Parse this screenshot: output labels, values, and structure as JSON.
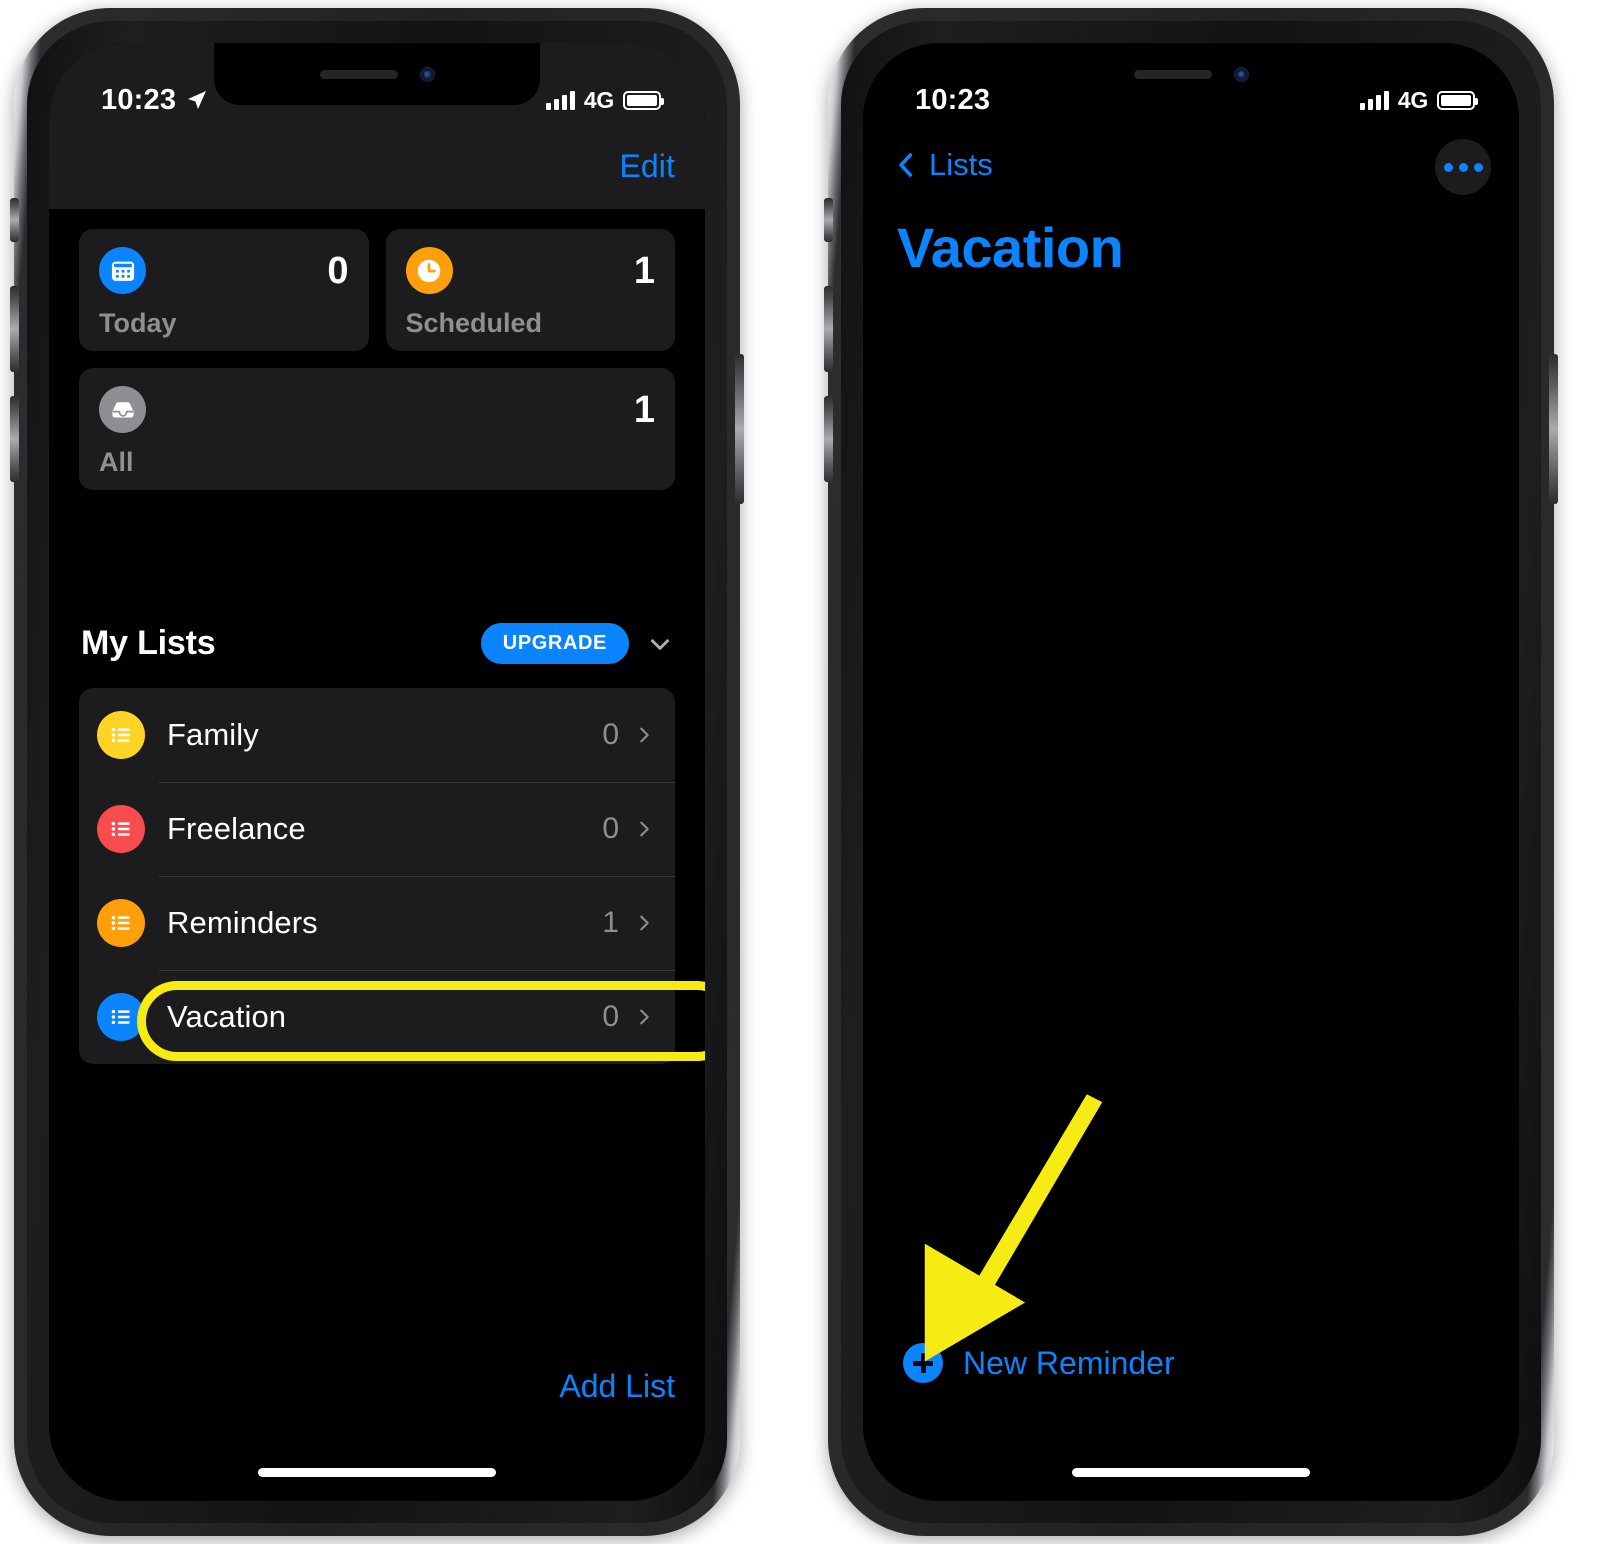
{
  "left_phone": {
    "status_bar": {
      "time": "10:23",
      "location_icon": "location-arrow-icon",
      "signal_icon": "cellular-bars-icon",
      "network": "4G",
      "battery_icon": "battery-full-icon"
    },
    "nav": {
      "edit_label": "Edit"
    },
    "smart_lists": [
      {
        "id": "today",
        "label": "Today",
        "count": "0",
        "icon": "calendar-icon",
        "color": "#0a84ff"
      },
      {
        "id": "scheduled",
        "label": "Scheduled",
        "count": "1",
        "icon": "clock-icon",
        "color": "#ff9f0a"
      },
      {
        "id": "all",
        "label": "All",
        "count": "1",
        "icon": "inbox-tray-icon",
        "color": "#8e8e93"
      }
    ],
    "my_lists_header": {
      "title": "My Lists",
      "upgrade_label": "UPGRADE",
      "collapse_icon": "chevron-down-icon"
    },
    "lists": [
      {
        "name": "Family",
        "count": "0",
        "color": "#ffd426",
        "icon": "list-bullet-icon",
        "chevron": "chevron-right-icon",
        "highlighted": false
      },
      {
        "name": "Freelance",
        "count": "0",
        "color": "#f94c4c",
        "icon": "list-bullet-icon",
        "chevron": "chevron-right-icon",
        "highlighted": false
      },
      {
        "name": "Reminders",
        "count": "1",
        "color": "#ff9f0a",
        "icon": "list-bullet-icon",
        "chevron": "chevron-right-icon",
        "highlighted": false
      },
      {
        "name": "Vacation",
        "count": "0",
        "color": "#0a84ff",
        "icon": "list-bullet-icon",
        "chevron": "chevron-right-icon",
        "highlighted": true
      }
    ],
    "footer": {
      "add_list_label": "Add List"
    },
    "annotation": {
      "highlight_color": "#f6ec13",
      "target": "Vacation"
    }
  },
  "right_phone": {
    "status_bar": {
      "time": "10:23",
      "signal_icon": "cellular-bars-icon",
      "network": "4G",
      "battery_icon": "battery-full-icon"
    },
    "nav": {
      "back_label": "Lists",
      "back_icon": "chevron-left-icon",
      "more_icon": "ellipsis-icon"
    },
    "title": "Vacation",
    "title_color": "#0a84ff",
    "reminders": [],
    "footer": {
      "new_reminder_label": "New Reminder",
      "new_reminder_icon": "plus-circle-icon"
    },
    "annotation": {
      "arrow_color": "#f6ec13",
      "points_to": "New Reminder"
    }
  }
}
